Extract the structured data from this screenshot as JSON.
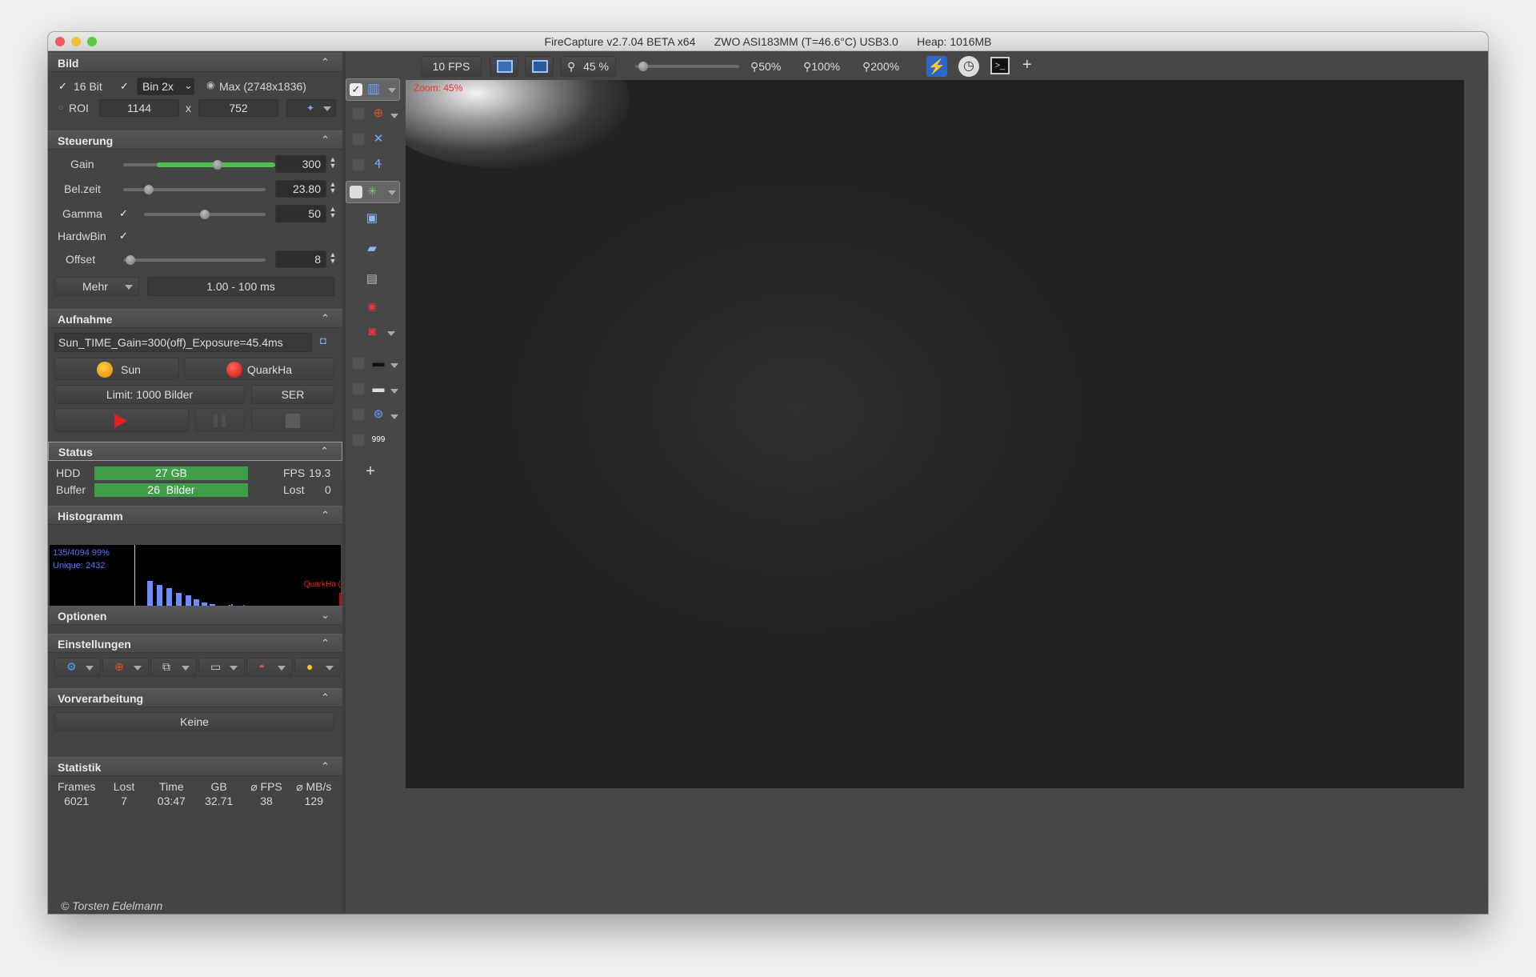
{
  "window": {
    "title": "FireCapture v2.7.04 BETA x64      ZWO ASI183MM (T=46.6°C) USB3.0      Heap: 1016MB",
    "colors": {
      "close": "#ee5d55",
      "minimize": "#f6be37",
      "maximize": "#5cc840",
      "accent_green": "#4fbf4f",
      "bar_green": "#3f9f48",
      "zoom_label": "#ee3333"
    }
  },
  "bild": {
    "title": "Bild",
    "bit_label": "16 Bit",
    "bin_value": "Bin 2x",
    "max_label": "Max (2748x1836)",
    "roi_label": "ROI",
    "roi_width": "1144",
    "roi_x": "x",
    "roi_height": "752"
  },
  "steuerung": {
    "title": "Steuerung",
    "gain_label": "Gain",
    "gain_value": "300",
    "gain_slider_pct": 0.62,
    "belzeit_label": "Bel.zeit",
    "belzeit_value": "23.80",
    "belzeit_slider_pct": 0.18,
    "gamma_label": "Gamma",
    "gamma_value": "50",
    "gamma_slider_pct": 0.5,
    "hardwbin_label": "HardwBin",
    "offset_label": "Offset",
    "offset_value": "8",
    "offset_slider_pct": 0.05,
    "mehr_label": "Mehr",
    "range_text": "1.00 - 100 ms"
  },
  "aufnahme": {
    "title": "Aufnahme",
    "filename": "Sun_TIME_Gain=300(off)_Exposure=45.4ms",
    "profile_label": "Sun",
    "filter_label": "QuarkHa",
    "limit_label": "Limit: 1000 Bilder",
    "format_label": "SER"
  },
  "status": {
    "title": "Status",
    "hdd_label": "HDD",
    "hdd_value": "27 GB",
    "buffer_label": "Buffer",
    "buffer_value": "26  Bilder",
    "fps_label": "FPS",
    "fps_value": "19.3",
    "lost_label": "Lost",
    "lost_value": "0"
  },
  "histogramm": {
    "title": "Histogramm",
    "line1": "135/4094 99%",
    "line2": "Unique: 2432",
    "filter_tag": "QuarkHa ("
  },
  "optionen": {
    "title": "Optionen"
  },
  "einstellungen": {
    "title": "Einstellungen"
  },
  "vorverarbeitung": {
    "title": "Vorverarbeitung",
    "value": "Keine"
  },
  "statistik": {
    "title": "Statistik",
    "headers": [
      "Frames",
      "Lost",
      "Time",
      "GB",
      "⌀ FPS",
      "⌀ MB/s"
    ],
    "values": [
      "6021",
      "7",
      "03:47",
      "32.71",
      "38",
      "129"
    ]
  },
  "toolbar": {
    "fps": "10 FPS",
    "zoom_value": "45 %",
    "zoom_slider_pct": 0.08,
    "zoom50": "50%",
    "zoom100": "100%",
    "zoom200": "200%",
    "add": "+"
  },
  "image": {
    "zoom_label": "Zoom: 45%"
  },
  "copyright": "© Torsten Edelmann"
}
